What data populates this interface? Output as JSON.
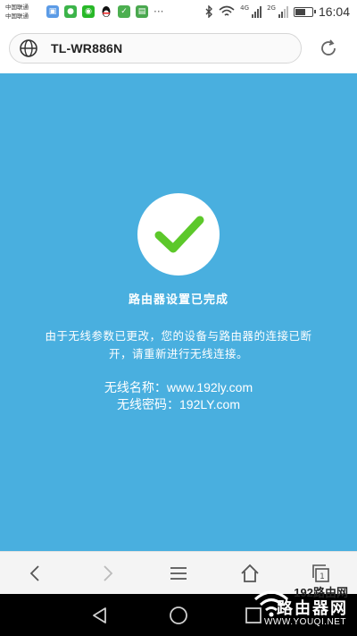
{
  "status_bar": {
    "carrier_line_1": "中国联通",
    "carrier_line_2": "中国联通",
    "notification_icons": [
      "image-icon",
      "chat-icon",
      "wechat-icon",
      "qq-icon",
      "app-icon",
      "app-icon"
    ],
    "more": "···",
    "network_1": "4G",
    "network_2": "2G",
    "time": "16:04",
    "battery_level": 0.55
  },
  "browser": {
    "url": "TL-WR886N"
  },
  "page": {
    "title": "路由器设置已完成",
    "message": "由于无线参数已更改，您的设备与路由器的连接已断开，请重新进行无线连接。",
    "wifi_name_label": "无线名称：",
    "wifi_name": "www.192ly.com",
    "wifi_password_label": "无线密码：",
    "wifi_password": "192LY.com"
  },
  "watermark": {
    "number": "192路由网",
    "chinese": "路由器网",
    "english": "WWW.YOUQI.NET"
  },
  "colors": {
    "content_bg": "#49afdf",
    "check_green": "#5cc82a"
  }
}
